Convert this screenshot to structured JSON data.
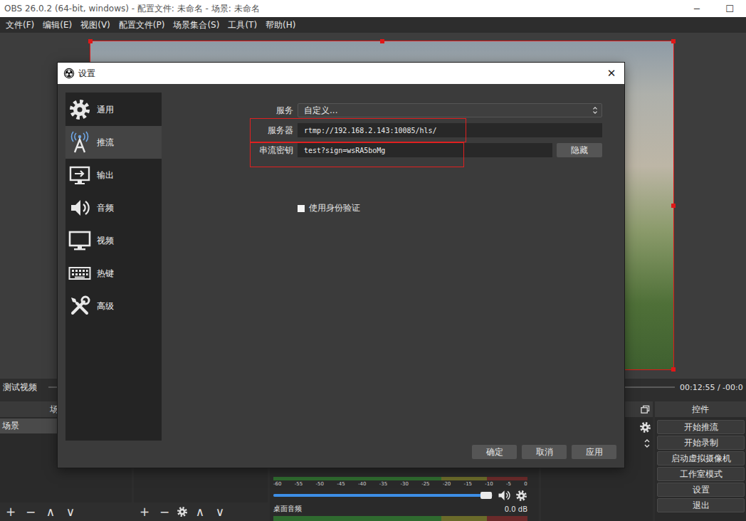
{
  "window": {
    "title": "OBS 26.0.2 (64-bit, windows) - 配置文件: 未命名 - 场景: 未命名",
    "controls": [
      "─",
      "☐"
    ]
  },
  "menu": [
    "文件(F)",
    "编辑(E)",
    "视图(V)",
    "配置文件(P)",
    "场景集合(S)",
    "工具(T)",
    "帮助(H)"
  ],
  "preview": {
    "selected": true
  },
  "player": {
    "title": "测试视频",
    "time": "00:12:55 / -00:0"
  },
  "scenes_dock": {
    "title": "场",
    "items": [
      {
        "label": "场景",
        "selected": true
      }
    ],
    "toolbar": [
      "+",
      "−",
      "∧",
      "∨"
    ]
  },
  "sources_dock": {
    "toolbar": [
      "+",
      "−",
      "∧",
      "∨"
    ]
  },
  "mixer": {
    "meter_level": 0,
    "scale": [
      "-60",
      "-55",
      "-50",
      "-45",
      "-40",
      "-35",
      "-30",
      "-25",
      "-20",
      "-15",
      "-10",
      "-5",
      "0"
    ],
    "volume_level": 0.97,
    "muted": false,
    "channel": {
      "name": "桌面音频",
      "reading": "0.0 dB",
      "meter_level": 0
    }
  },
  "controls_dock": {
    "title": "控件",
    "buttons": [
      "开始推流",
      "开始录制",
      "启动虚拟摄像机",
      "工作室模式",
      "设置",
      "退出"
    ]
  },
  "dialog": {
    "title": "设置",
    "close": "✕",
    "nav": [
      {
        "label": "通用",
        "selected": false
      },
      {
        "label": "推流",
        "selected": true
      },
      {
        "label": "输出",
        "selected": false
      },
      {
        "label": "音频",
        "selected": false
      },
      {
        "label": "视频",
        "selected": false
      },
      {
        "label": "热键",
        "selected": false
      },
      {
        "label": "高级",
        "selected": false
      }
    ],
    "fields": [
      {
        "label": "服务",
        "kind": "dropdown",
        "value": "自定义...",
        "highlighted": false
      },
      {
        "label": "服务器",
        "kind": "text",
        "value": "rtmp://192.168.2.143:10085/hls/",
        "highlighted": true
      },
      {
        "label": "串流密钥",
        "kind": "secret",
        "value": "test?sign=wsRA5boMg",
        "button": "隐藏",
        "highlighted": true
      }
    ],
    "auth": {
      "label": "使用身份验证",
      "checked": false
    },
    "buttons": [
      "确定",
      "取消",
      "应用"
    ]
  }
}
